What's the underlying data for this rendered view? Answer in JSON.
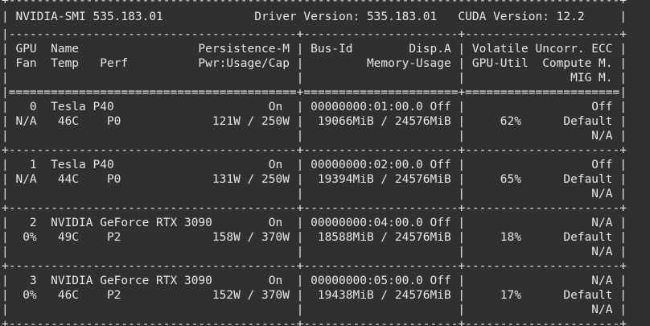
{
  "terminal": {
    "lines": [
      "+---------------------------------------------------------------------------------------+",
      "| NVIDIA-SMI 535.183.01             Driver Version: 535.183.01   CUDA Version: 12.2     |",
      "|-----------------------------------------+----------------------+----------------------+",
      "| GPU  Name                 Persistence-M | Bus-Id        Disp.A | Volatile Uncorr. ECC |",
      "| Fan  Temp   Perf          Pwr:Usage/Cap |         Memory-Usage | GPU-Util  Compute M. |",
      "|                                         |                      |               MIG M. |",
      "|=========================================+======================+======================|",
      "|   0  Tesla P40                      On  | 00000000:01:00.0 Off |                  Off |",
      "| N/A   46C    P0             121W / 250W |  19066MiB / 24576MiB |     62%      Default |",
      "|                                         |                      |                  N/A |",
      "+-----------------------------------------+----------------------+----------------------+",
      "|   1  Tesla P40                      On  | 00000000:02:00.0 Off |                  Off |",
      "| N/A   44C    P0             131W / 250W |  19394MiB / 24576MiB |     65%      Default |",
      "|                                         |                      |                  N/A |",
      "+-----------------------------------------+----------------------+----------------------+",
      "|   2  NVIDIA GeForce RTX 3090        On  | 00000000:04:00.0 Off |                  N/A |",
      "|  0%   49C    P2             158W / 370W |  18588MiB / 24576MiB |     18%      Default |",
      "|                                         |                      |                  N/A |",
      "+-----------------------------------------+----------------------+----------------------+",
      "|   3  NVIDIA GeForce RTX 3090        On  | 00000000:05:00.0 Off |                  N/A |",
      "|  0%   46C    P2             152W / 370W |  19438MiB / 24576MiB |     17%      Default |",
      "|                                         |                      |                  N/A |",
      "+-----------------------------------------+----------------------+----------------------+"
    ]
  },
  "colors": {
    "background": "#303030",
    "text": "#e6e6e6"
  }
}
